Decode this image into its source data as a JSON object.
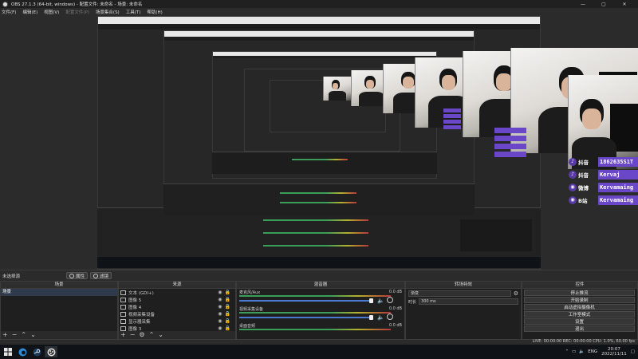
{
  "window": {
    "title": "OBS 27.1.3 (64-bit, windows) - 配置文件: 未命名 - 场景: 未命名",
    "controls": [
      "—",
      "▢",
      "✕"
    ]
  },
  "menu": [
    "文件(F)",
    "编辑(E)",
    "视图(V)",
    "配置文件(P)",
    "场景集合(S)",
    "工具(T)",
    "帮助(H)"
  ],
  "overlay": {
    "socials": [
      {
        "icon": "♪",
        "platform": "抖音",
        "handle": "1862635S1T"
      },
      {
        "icon": "♪",
        "platform": "抖音",
        "handle": "Kervaj"
      },
      {
        "icon": "◉",
        "platform": "微博",
        "handle": "Kervamaing"
      },
      {
        "icon": "◉",
        "platform": "B站",
        "handle": "Kervamaing"
      }
    ]
  },
  "scenebar": {
    "label": "未选择源",
    "properties": "属性",
    "filters": "滤镜"
  },
  "docks": {
    "scenes": {
      "title": "场景",
      "items": [
        "场景"
      ]
    },
    "sources": {
      "title": "来源",
      "items": [
        "文本 (GDI+)",
        "图像 5",
        "图像 4",
        "视频采集设备",
        "显示器采集",
        "图像 3"
      ]
    },
    "mixer": {
      "title": "混音器",
      "channels": [
        {
          "name": "麦克风/Aux",
          "db": "0.0 dB"
        },
        {
          "name": "视频采集设备",
          "db": "0.0 dB"
        },
        {
          "name": "桌面音频",
          "db": "0.0 dB"
        }
      ]
    },
    "transitions": {
      "title": "转场特效",
      "type": "渐变",
      "duration_label": "时长",
      "duration": "300 ms"
    },
    "controls": {
      "title": "控件",
      "buttons": [
        "停止推流",
        "开始录制",
        "启动虚拟摄像机",
        "工作室模式",
        "设置",
        "退出"
      ]
    }
  },
  "status": {
    "text": "LIVE: 00:00:00   REC: 00:00:00   CPU: 1.0%, 60.00 fps"
  },
  "taskbar": {
    "lang": "ENG",
    "time": "20:07",
    "date": "2022/11/11"
  }
}
